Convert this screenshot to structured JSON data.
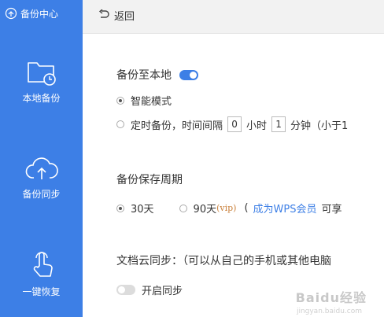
{
  "sidebar": {
    "title": "备份中心",
    "items": [
      {
        "label": "本地备份",
        "icon": "folder-clock-icon"
      },
      {
        "label": "备份同步",
        "icon": "cloud-upload-icon"
      },
      {
        "label": "一键恢复",
        "icon": "hand-pointer-icon"
      }
    ]
  },
  "topbar": {
    "back_label": "返回"
  },
  "local_backup": {
    "title": "备份至本地",
    "toggle_on": true,
    "smart_mode": "智能模式",
    "timed_backup_label": "定时备份，时间间隔",
    "hours_value": "0",
    "hours_unit": "小时",
    "minutes_value": "1",
    "minutes_unit": "分钟（小于1"
  },
  "retention": {
    "title": "备份保存周期",
    "option_30": "30天",
    "option_90": "90天",
    "vip_tag": "(vip)",
    "paren_open": "(",
    "member_link": "成为WPS会员",
    "member_suffix": "可享"
  },
  "cloud_sync": {
    "title": "文档云同步：（可以从自己的手机或其他电脑",
    "toggle_label": "开启同步"
  },
  "watermark": {
    "text": "Baidu经验",
    "sub": "jingyan.baidu.com"
  },
  "colors": {
    "accent": "#3d7fe6",
    "vip": "#c9803b"
  }
}
